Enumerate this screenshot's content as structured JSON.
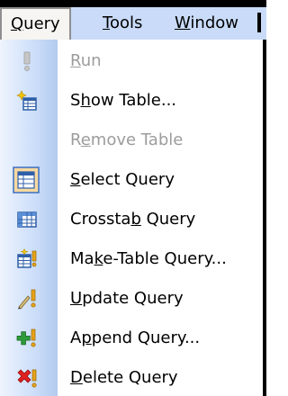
{
  "menubar": {
    "items": [
      {
        "pre": "",
        "key": "Q",
        "post": "uery",
        "active": true
      },
      {
        "pre": "",
        "key": "T",
        "post": "ools",
        "active": false
      },
      {
        "pre": "",
        "key": "W",
        "post": "indow",
        "active": false
      }
    ]
  },
  "dropdown": {
    "items": [
      {
        "pre": "",
        "key": "R",
        "post": "un",
        "icon": "run-exclamation-icon",
        "enabled": false
      },
      {
        "pre": "S",
        "key": "h",
        "post": "ow Table...",
        "icon": "show-table-icon",
        "enabled": true
      },
      {
        "pre": "R",
        "key": "e",
        "post": "move Table",
        "icon": "",
        "enabled": false
      },
      {
        "pre": "",
        "key": "S",
        "post": "elect Query",
        "icon": "select-query-icon",
        "enabled": true,
        "checked": true
      },
      {
        "pre": "Crossta",
        "key": "b",
        "post": " Query",
        "icon": "crosstab-query-icon",
        "enabled": true
      },
      {
        "pre": "Ma",
        "key": "k",
        "post": "e-Table Query...",
        "icon": "make-table-query-icon",
        "enabled": true
      },
      {
        "pre": "",
        "key": "U",
        "post": "pdate Query",
        "icon": "update-query-icon",
        "enabled": true
      },
      {
        "pre": "A",
        "key": "p",
        "post": "pend Query...",
        "icon": "append-query-icon",
        "enabled": true
      },
      {
        "pre": "",
        "key": "D",
        "post": "elete Query",
        "icon": "delete-query-icon",
        "enabled": true
      }
    ]
  },
  "colors": {
    "menubar_bg": "#c9dbf8",
    "gutter_light": "#eef4fd",
    "gutter_dark": "#b3cbef",
    "disabled_text": "#9c9c9c"
  }
}
